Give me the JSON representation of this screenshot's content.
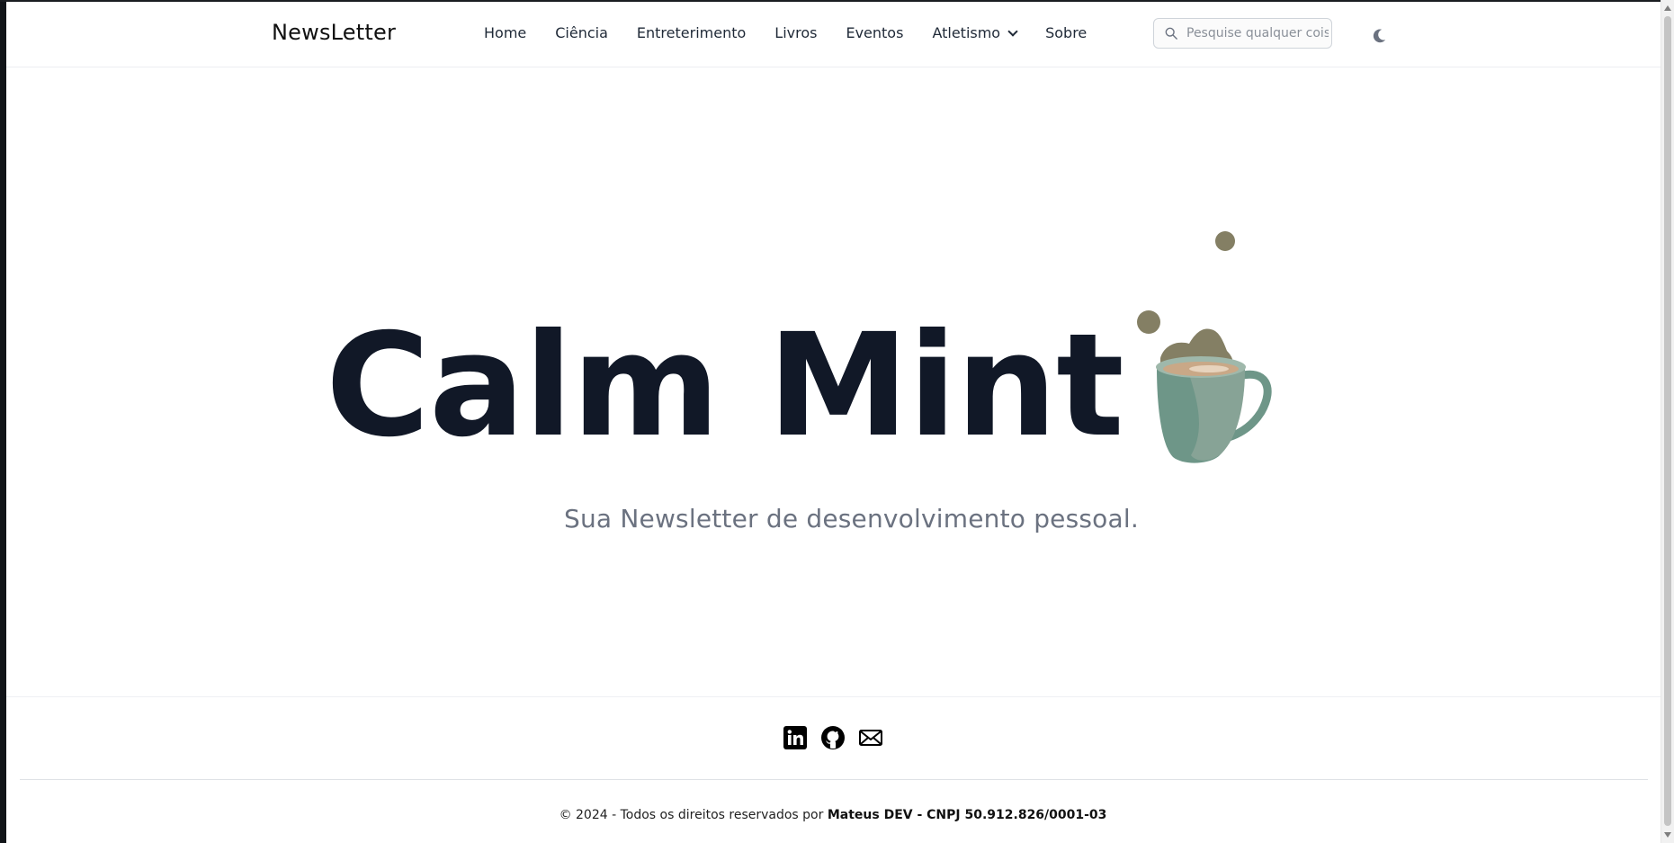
{
  "header": {
    "brand": "NewsLetter",
    "nav": [
      {
        "label": "Home"
      },
      {
        "label": "Ciência"
      },
      {
        "label": "Entreterimento"
      },
      {
        "label": "Livros"
      },
      {
        "label": "Eventos"
      },
      {
        "label": "Atletismo",
        "has_dropdown": true
      },
      {
        "label": "Sobre"
      }
    ],
    "search": {
      "placeholder": "Pesquise qualquer coisa.",
      "value": ""
    },
    "theme_toggle_icon": "moon-icon"
  },
  "hero": {
    "title": "Calm Mint",
    "subtitle": "Sua Newsletter de desenvolvimento pessoal.",
    "illustration": "coffee-cup-illustration"
  },
  "footer": {
    "socials": [
      {
        "icon": "linkedin-icon"
      },
      {
        "icon": "github-icon"
      },
      {
        "icon": "mail-icon"
      }
    ],
    "copyright_prefix": "© 2024 - Todos os direitos reservados por",
    "copyright_owner": "Mateus DEV - CNPJ 50.912.826/0001-03"
  },
  "colors": {
    "text": "#111827",
    "muted": "#6b7280",
    "cup": "#6e9688",
    "blob": "#847f64"
  }
}
